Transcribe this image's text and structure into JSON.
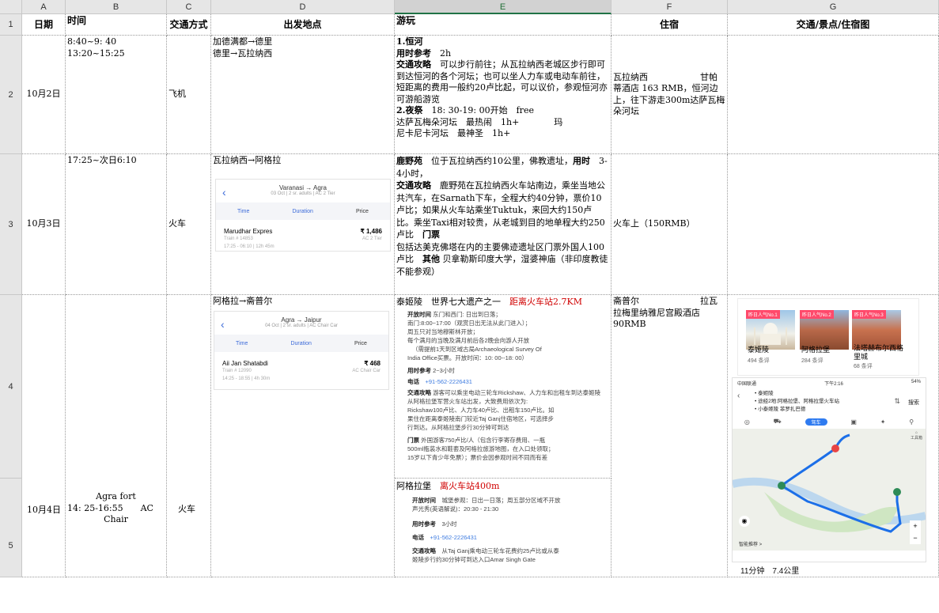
{
  "columns": [
    "A",
    "B",
    "C",
    "D",
    "E",
    "F",
    "G"
  ],
  "selected_column": "E",
  "rows": [
    "1",
    "2",
    "3",
    "4",
    "5"
  ],
  "headers": {
    "date": "日期",
    "time": "时间",
    "transport": "交通方式",
    "departure": "出发地点",
    "play": "游玩",
    "stay": "住宿",
    "map_col": "交通/景点/住宿图"
  },
  "row2": {
    "date": "10月2日",
    "time_line1": "8:40~9: 40",
    "time_line2": "13:20~15:25",
    "transport": "飞机",
    "dep_line1": "加德满都→德里",
    "dep_line2": "德里→瓦拉纳西",
    "play_title": "1.恒河",
    "play_time_label": "用时参考",
    "play_time_value": "2h",
    "play_traffic_label": "交通攻略",
    "play_traffic_text": "可以步行前往；从瓦拉纳西老城区步行即可到达恒河的各个河坛；也可以坐人力车或电动车前往，短距离的费用一般约20卢比起，可以议价，参观恒河亦可游船游览",
    "play_night_title": "2.夜祭",
    "play_night_time": "18: 30-19: 00开始",
    "play_night_free": "free",
    "play_night_line2": "达萨瓦梅朵河坛　最热闹　1h+　　　　玛",
    "play_night_line3": "尼卡尼卡河坛　最神圣　1h+",
    "stay": "瓦拉纳西　　　　　　甘帕蒂酒店 163 RMB，恒河边上，往下游走300m达萨瓦梅朵河坛"
  },
  "row3": {
    "date": "10月3日",
    "time": "17:25~次日6:10",
    "transport": "火车",
    "departure": "瓦拉纳西→阿格拉",
    "app": {
      "route": "Varanasi → Agra",
      "sub": "03 Oct | 2 sr. adults | AC 2 Tier",
      "col_time": "Time",
      "col_duration": "Duration",
      "col_price": "Price",
      "train_name": "Marudhar Expres",
      "price": "₹ 1,486",
      "train_no": "Train # 14853",
      "class": "AC 2 Tier",
      "schedule": "17:25 - 06:10 | 12h 45m"
    },
    "play_title": "鹿野苑",
    "play_intro": "位于瓦拉纳西约10公里，佛教遗址，",
    "play_time_label": "用时",
    "play_time_value": "3-4小时，",
    "play_traffic_label": "交通攻略",
    "play_traffic_text": "鹿野苑在瓦拉纳西火车站南边，乘坐当地公共汽车，在Sarnath下车，全程大约40分钟，票价10 卢比；如果从火车站乘坐Tuktuk，来回大约150卢比。乘坐Taxi相对较贵，从老城到目的地单程大约250卢比",
    "play_ticket_label": "门票",
    "play_ticket_text": "包括达美克佛塔在内的主要佛迹遗址区门票外国人100卢比",
    "play_other_label": "其他",
    "play_other_text": "贝拿勒斯印度大学，湿婆神庙（非印度教徒不能参观）",
    "stay": "火车上（150RMB）"
  },
  "row4": {
    "date": "10月4日",
    "time_line1": "Agra fort",
    "time_line2": "14: 25-16:55　　AC",
    "time_line3": "Chair",
    "transport": "火车",
    "departure": "阿格拉→斋普尔",
    "app": {
      "route": "Agra → Jaipur",
      "sub": "04 Oct | 2 sr. adults | AC Chair Car",
      "col_time": "Time",
      "col_duration": "Duration",
      "col_price": "Price",
      "train_name": "Aii Jan Shatabdi",
      "price": "₹ 468",
      "train_no": "Train # 12090",
      "class": "AC Chair Car",
      "schedule": "14:25 - 18:55 | 4h 30m"
    },
    "taj_title": "泰姬陵　世界七大遗产之一",
    "taj_dist": "距离火车站2.7KM",
    "taj_doc": {
      "open_label": "开放时间",
      "open_text": "东门和西门: 日出到日落；",
      "open_2": "南门:8:00~17:00（观赏日出无法从此门进入）；",
      "open_3": "周五只对当地穆斯林开放；",
      "open_4": "每个满月的当晚及满月前后各2晚会向游人开放",
      "open_5": "（需提前1天到区域古局Archaeological Survey Of",
      "open_6": "India Office买票。开放时间：10: 00--18: 00）",
      "time_label": "用时参考",
      "time_text": "2~3小时",
      "phone_label": "电话",
      "phone": "+91-562-2226431",
      "traffic_label": "交通攻略",
      "traffic_text": "游客可以乘坐电动三轮车Rickshaw、人力车和出租车到达泰姬陵",
      "traffic_2": "从阿格拉堡军营火车站出发，大致费用依次为:",
      "traffic_3": "Rickshaw100卢比、人力车40卢比、出租车150卢比。如",
      "traffic_4": "果住在距离泰姬陵南门较近Taj Ganj住宿地区，可选择步",
      "traffic_5": "行到达。从阿格拉堡步行30分钟可到达",
      "ticket_label": "门票",
      "ticket_text": "外国游客750卢比/人（包含行李寄存费用、一瓶",
      "ticket_2": "500ml瓶装水和鞋套及阿格拉旅游地图，在入口处领取；",
      "ticket_3": "15岁以下青少年免票）；票价会因参观时间不同而有差"
    },
    "fort_title": "阿格拉堡",
    "fort_dist": "离火车站400m",
    "fort_doc": {
      "open_label": "开放时间",
      "open_text": "城堡参观：日出一日落；周五部分区域不开放",
      "open_2": "声光秀(英语解说)：20:30 - 21:30",
      "time_label": "用时参考",
      "time_text": "3小时",
      "phone_label": "电话",
      "phone": "+91-562-2226431",
      "traffic_label": "交通攻略",
      "traffic_text": "从Taj Ganj乘电动三轮车花费约25卢比或从泰",
      "traffic_2": "姬陵步行约30分钟可到达入口Amar Singh Gate"
    },
    "stay": "斋普尔　　　　　　　拉瓦拉梅里纳雅尼宫殿酒店　90RMB",
    "attractions": [
      {
        "tag": "昨日人气No.1",
        "name": "泰姬陵",
        "count": "494 条评"
      },
      {
        "tag": "昨日人气No.2",
        "name": "阿格拉堡",
        "count": "284 条评"
      },
      {
        "tag": "昨日人气No.3",
        "name": "法塔赫布尔西格里城",
        "count": "68 条评"
      }
    ],
    "phone_status": {
      "carrier": "中国联通",
      "time": "下午2:16",
      "battery": "54%"
    },
    "map_route": [
      "泰姬陵",
      "途经2地:阿格拉堡、阿格拉堡火车站",
      "小泰姬陵 菲罗扎巴德"
    ],
    "map_search": "搜索",
    "map_mode": "驾车",
    "map_footer_left": "智能推荐 >",
    "map_duration": "11分钟　7.4公里",
    "map_labels": {
      "shop": "工具箱"
    }
  }
}
